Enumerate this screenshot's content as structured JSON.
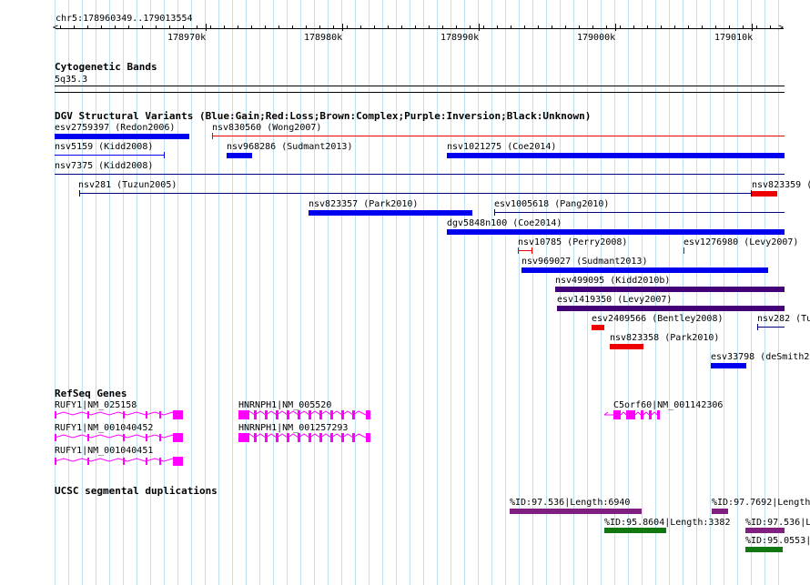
{
  "ruler": {
    "location": "chr5:178960349..179013554",
    "ticks": [
      "178970k",
      "178980k",
      "178990k",
      "179000k",
      "179010k"
    ]
  },
  "cyto": {
    "title": "Cytogenetic Bands",
    "band": "5q35.3"
  },
  "dgv": {
    "title": "DGV Structural Variants (Blue:Gain;Red:Loss;Brown:Complex;Purple:Inversion;Black:Unknown)",
    "features": [
      {
        "label": "esv2759397 (Redon2006)",
        "color": "#0000ee"
      },
      {
        "label": "nsv830560 (Wong2007)",
        "color": "#ee0000"
      },
      {
        "label": "nsv5159 (Kidd2008)",
        "color": "#0000ee"
      },
      {
        "label": "nsv968286 (Sudmant2013)",
        "color": "#0000ee"
      },
      {
        "label": "nsv1021275 (Coe2014)",
        "color": "#0000ee"
      },
      {
        "label": "nsv7375 (Kidd2008)",
        "color": "#000080"
      },
      {
        "label": "nsv281 (Tuzun2005)",
        "color": "#000080"
      },
      {
        "label": "nsv823359 (",
        "color": "#ee0000"
      },
      {
        "label": "nsv823357 (Park2010)",
        "color": "#0000ee"
      },
      {
        "label": "esv1005618 (Pang2010)",
        "color": "#000080"
      },
      {
        "label": "dgv5848n100 (Coe2014)",
        "color": "#0000ee"
      },
      {
        "label": "nsv10785 (Perry2008)",
        "color": "#ee0000"
      },
      {
        "label": "esv1276980 (Levy2007)",
        "color": "#ee0000"
      },
      {
        "label": "nsv969027 (Sudmant2013)",
        "color": "#0000ee"
      },
      {
        "label": "nsv499095 (Kidd2010b)",
        "color": "#440077"
      },
      {
        "label": "esv1419350 (Levy2007)",
        "color": "#440077"
      },
      {
        "label": "esv2409566 (Bentley2008)",
        "color": "#ee0000"
      },
      {
        "label": "nsv282 (Tu",
        "color": "#000080"
      },
      {
        "label": "nsv823358 (Park2010)",
        "color": "#ee0000"
      },
      {
        "label": "esv33798 (deSmith2",
        "color": "#0000ee"
      }
    ]
  },
  "refseq": {
    "title": "RefSeq Genes",
    "genes": [
      {
        "label": "RUFY1|NM_025158"
      },
      {
        "label": "RUFY1|NM_001040452"
      },
      {
        "label": "RUFY1|NM_001040451"
      },
      {
        "label": "HNRNPH1|NM_005520"
      },
      {
        "label": "HNRNPH1|NM_001257293"
      },
      {
        "label": "C5orf60|NM_001142306"
      }
    ],
    "color": "#ff00ff"
  },
  "segdup": {
    "title": "UCSC segmental duplications",
    "features": [
      {
        "label": "%ID:97.536|Length:6940",
        "color": "#7f1f7f"
      },
      {
        "label": "%ID:97.7692|Length",
        "color": "#7f1f7f"
      },
      {
        "label": "%ID:95.8604|Length:3382",
        "color": "#117711"
      },
      {
        "label": "%ID:97.536|L",
        "color": "#7f1f7f"
      },
      {
        "label": "%ID:95.0553|",
        "color": "#117711"
      }
    ]
  }
}
